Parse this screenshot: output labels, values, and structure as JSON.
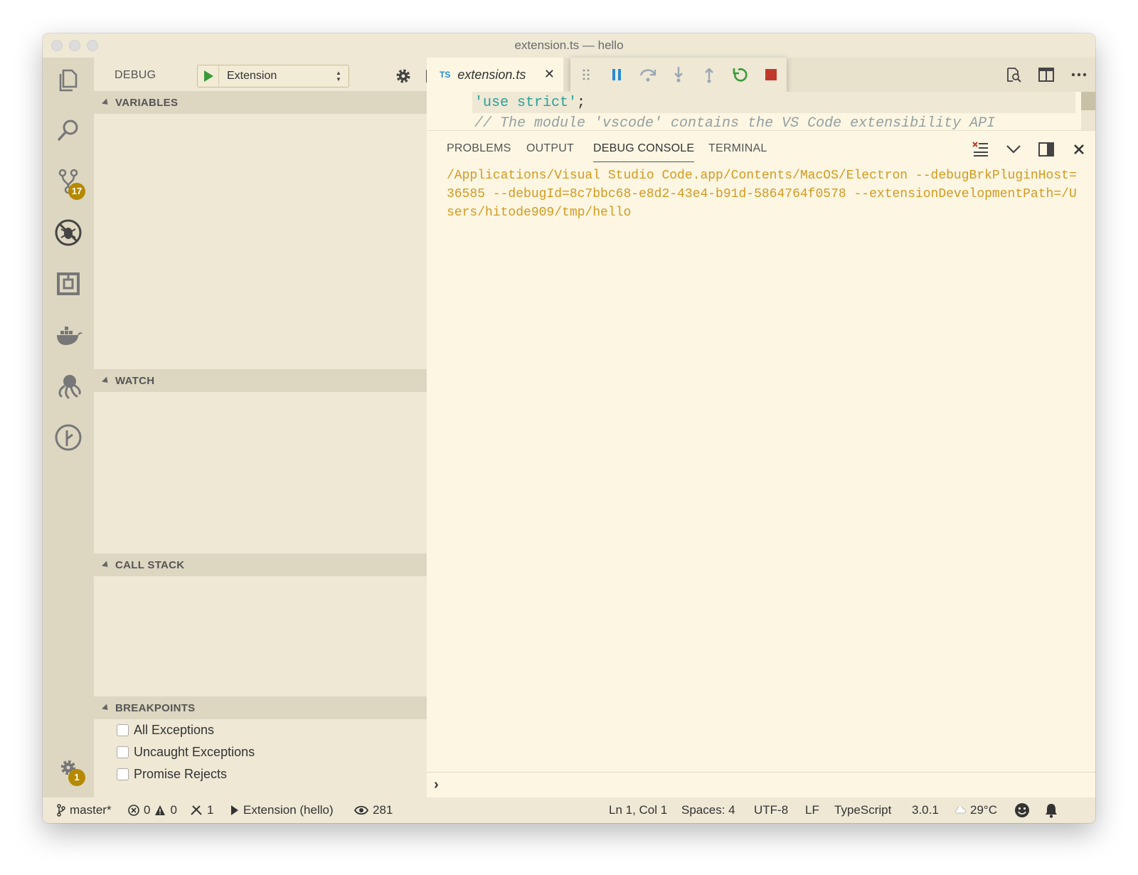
{
  "window": {
    "title": "extension.ts — hello"
  },
  "activity": {
    "scm_badge": "17",
    "settings_badge": "1"
  },
  "sidebar": {
    "title": "DEBUG",
    "config_name": "Extension",
    "sections": {
      "variables": "VARIABLES",
      "watch": "WATCH",
      "call_stack": "CALL STACK",
      "breakpoints": "BREAKPOINTS"
    },
    "breakpoints": [
      {
        "label": "All Exceptions",
        "checked": false
      },
      {
        "label": "Uncaught Exceptions",
        "checked": false
      },
      {
        "label": "Promise Rejects",
        "checked": false
      }
    ]
  },
  "editor": {
    "tab": {
      "lang": "TS",
      "name": "extension.ts",
      "close": "✕"
    },
    "code": {
      "line1_str": "'use strict'",
      "line1_punc": ";",
      "line2": "// The module 'vscode' contains the VS Code extensibility API"
    }
  },
  "panel": {
    "tabs": [
      "PROBLEMS",
      "OUTPUT",
      "DEBUG CONSOLE",
      "TERMINAL"
    ],
    "active_tab": "DEBUG CONSOLE",
    "output": "/Applications/Visual Studio Code.app/Contents/MacOS/Electron --debugBrkPluginHost=36585 --debugId=8c7bbc68-e8d2-43e4-b91d-5864764f0578 --extensionDevelopmentPath=/Users/hitode909/tmp/hello",
    "prompt": "›"
  },
  "statusbar": {
    "branch": "master*",
    "errors": "0",
    "warnings": "0",
    "tools": "1",
    "debug_session": "Extension (hello)",
    "watchers": "281",
    "position": "Ln 1, Col 1",
    "spaces": "Spaces: 4",
    "encoding": "UTF-8",
    "eol": "LF",
    "language": "TypeScript",
    "version": "3.0.1",
    "weather": "29°C"
  },
  "colors": {
    "accent": "#b58900",
    "console_text": "#d39a1e",
    "string": "#2aa198",
    "stop": "#c0392b",
    "restart": "#3a9a3a",
    "pause": "#268bd2"
  }
}
